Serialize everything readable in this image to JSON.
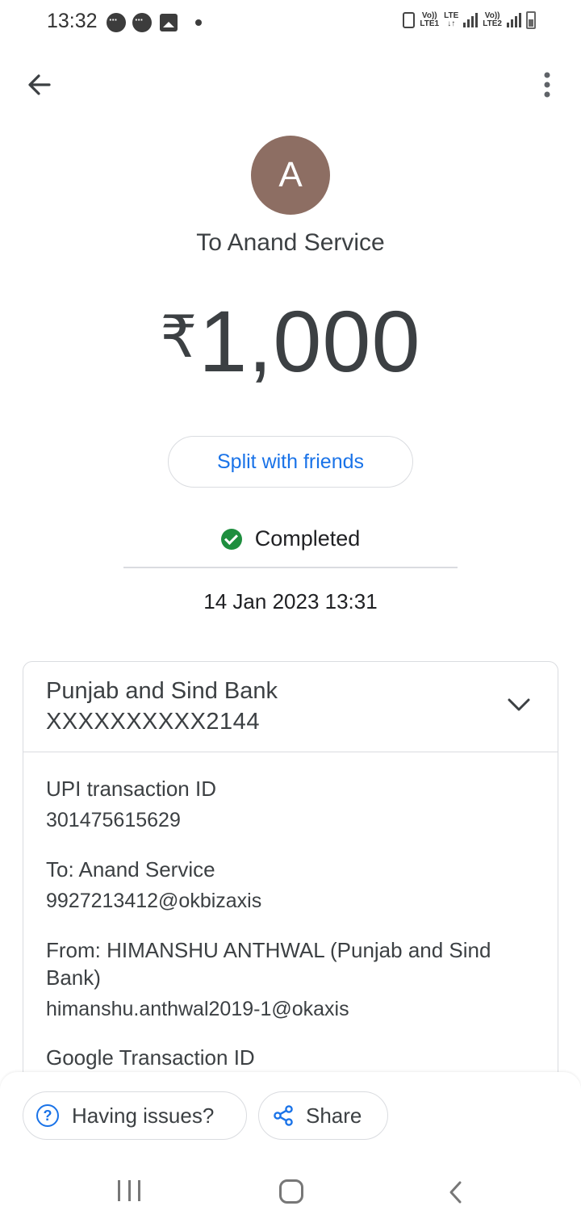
{
  "status_bar": {
    "time": "13:32",
    "sig1_top": "Vo))",
    "sig1_bottom": "LTE1",
    "lte_top": "LTE",
    "lte_bottom": "↓↑",
    "sig2_top": "Vo))",
    "sig2_bottom": "LTE2"
  },
  "header": {
    "back_icon": "arrow-left-icon",
    "menu_icon": "more-vert-icon"
  },
  "payee": {
    "avatar_letter": "A",
    "avatar_color": "#8d6e63",
    "to_line": "To Anand Service"
  },
  "amount": {
    "currency": "₹",
    "value": "1,000"
  },
  "split_button": "Split with friends",
  "status": {
    "text": "Completed",
    "color": "#1e8e3e"
  },
  "date": "14 Jan 2023 13:31",
  "bank_card": {
    "bank_name": "Punjab and Sind Bank",
    "account": "XXXXXXXXXX2144",
    "details": [
      {
        "label": "UPI transaction ID",
        "value": "301475615629"
      },
      {
        "label": "To: Anand Service",
        "value": "9927213412@okbizaxis"
      },
      {
        "label": "From: HIMANSHU ANTHWAL (Punjab and Sind Bank)",
        "value": "himanshu.anthwal2019-1@okaxis"
      },
      {
        "label": "Google Transaction ID",
        "value": ""
      }
    ]
  },
  "bottom_actions": {
    "issues_label": "Having issues?",
    "share_label": "Share"
  },
  "accent_color": "#1a73e8"
}
